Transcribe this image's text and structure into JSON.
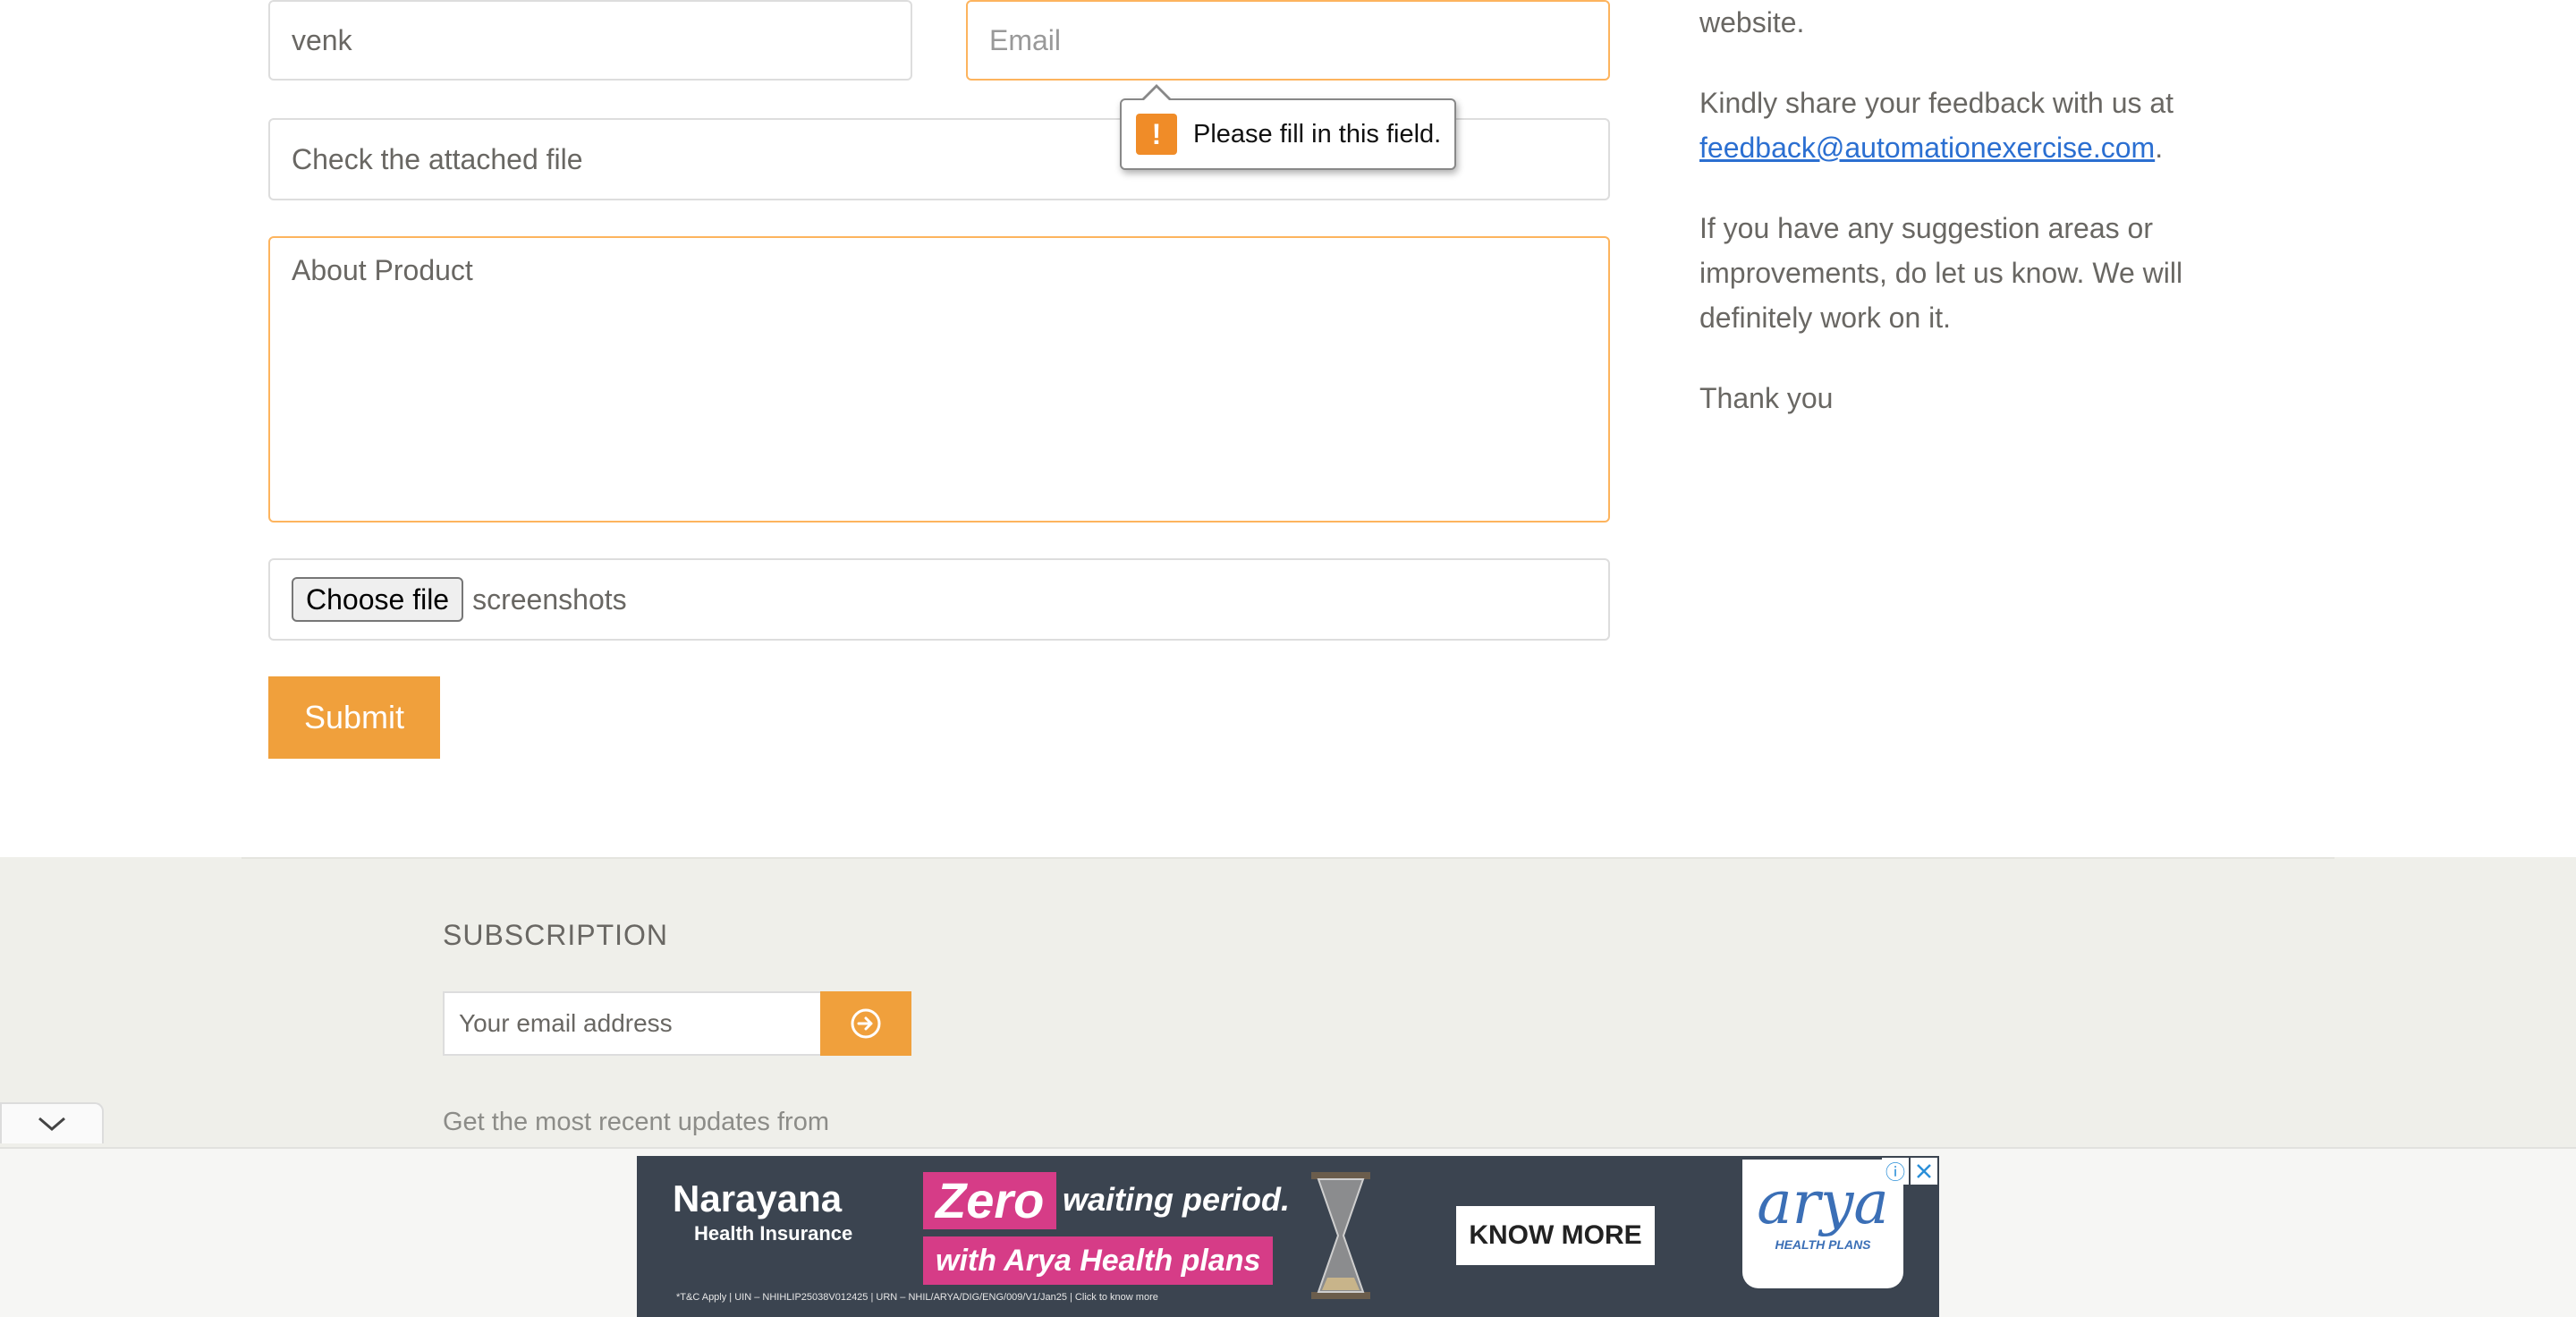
{
  "form": {
    "name_value": "venk",
    "email_placeholder": "Email",
    "subject_value": "Check the attached file",
    "message_value": "About Product",
    "choose_file_label": "Choose file",
    "file_name": "screenshots",
    "submit_label": "Submit",
    "validation_message": "Please fill in this field.",
    "validation_icon": "warning-icon"
  },
  "side": {
    "website_text": "website.",
    "feedback_prefix": "Kindly share your feedback with us at",
    "feedback_email": "feedback@automationexercise.com",
    "feedback_suffix": ".",
    "suggest_text": "If you have any suggestion areas or improvements, do let us know. We will definitely work on it.",
    "thanks_text": "Thank you"
  },
  "footer": {
    "subscription_title": "SUBSCRIPTION",
    "email_placeholder": "Your email address",
    "subscribe_icon": "arrow-circle-right-icon",
    "description_line": "Get the most recent updates from"
  },
  "ad": {
    "brand_name": "Narayana",
    "brand_sub": "Health Insurance",
    "headline_zero": "Zero",
    "headline_rest": "waiting period.",
    "headline_line2": "with Arya Health plans",
    "cta": "KNOW MORE",
    "logo_text": "arya",
    "logo_sub": "HEALTH PLANS",
    "fine_print": "*T&C Apply | UIN – NHIHLIP25038V012425 | URN – NHIL/ARYA/DIG/ENG/009/V1/Jan25 | Click to know more"
  },
  "colors": {
    "accent": "#f0a03c",
    "link": "#2b6fd1",
    "footer_bg": "#efefea",
    "focus_border": "#fdb45e"
  }
}
